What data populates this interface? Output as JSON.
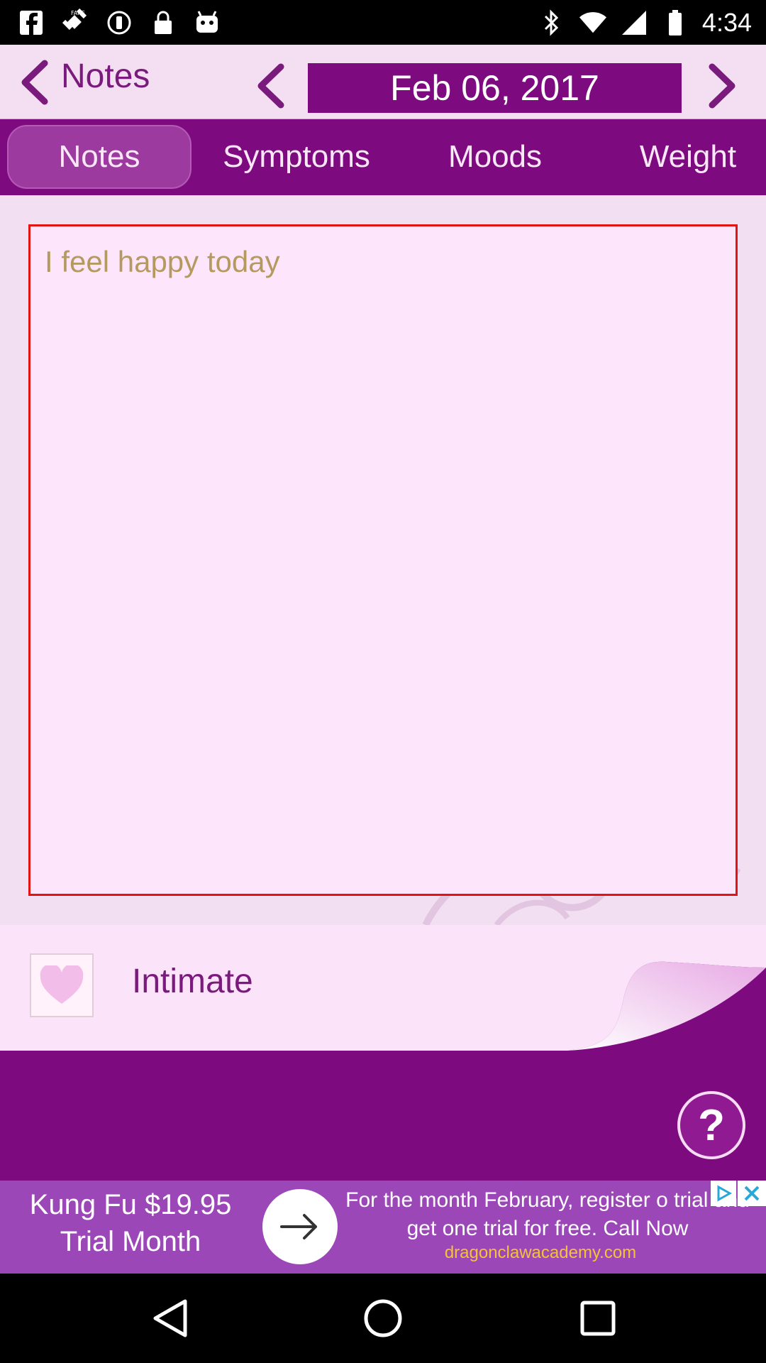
{
  "status_bar": {
    "time": "4:34",
    "left_icons": [
      "facebook-icon",
      "fake-gps-icon",
      "sync-icon",
      "lock-icon",
      "android-icon"
    ],
    "right_icons": [
      "bluetooth-icon",
      "wifi-icon",
      "signal-icon",
      "battery-icon"
    ]
  },
  "header": {
    "back_label": "Notes",
    "date": "Feb 06, 2017"
  },
  "tabs": [
    {
      "label": "Notes",
      "active": true
    },
    {
      "label": "Symptoms",
      "active": false
    },
    {
      "label": "Moods",
      "active": false
    },
    {
      "label": "Weight",
      "active": false
    }
  ],
  "note": {
    "text": "I feel happy today"
  },
  "intimate": {
    "label": "Intimate",
    "checked": false
  },
  "help": {
    "label": "?"
  },
  "ad": {
    "title": "Kung Fu $19.95 Trial Month",
    "body": "For the month February, register o trial and get one trial for free. Call Now",
    "url": "dragonclawacademy.com"
  },
  "colors": {
    "primary_purple": "#7e0a80",
    "header_bg": "#f3dff1",
    "note_border": "#e21313",
    "note_text": "#b59a5f"
  }
}
